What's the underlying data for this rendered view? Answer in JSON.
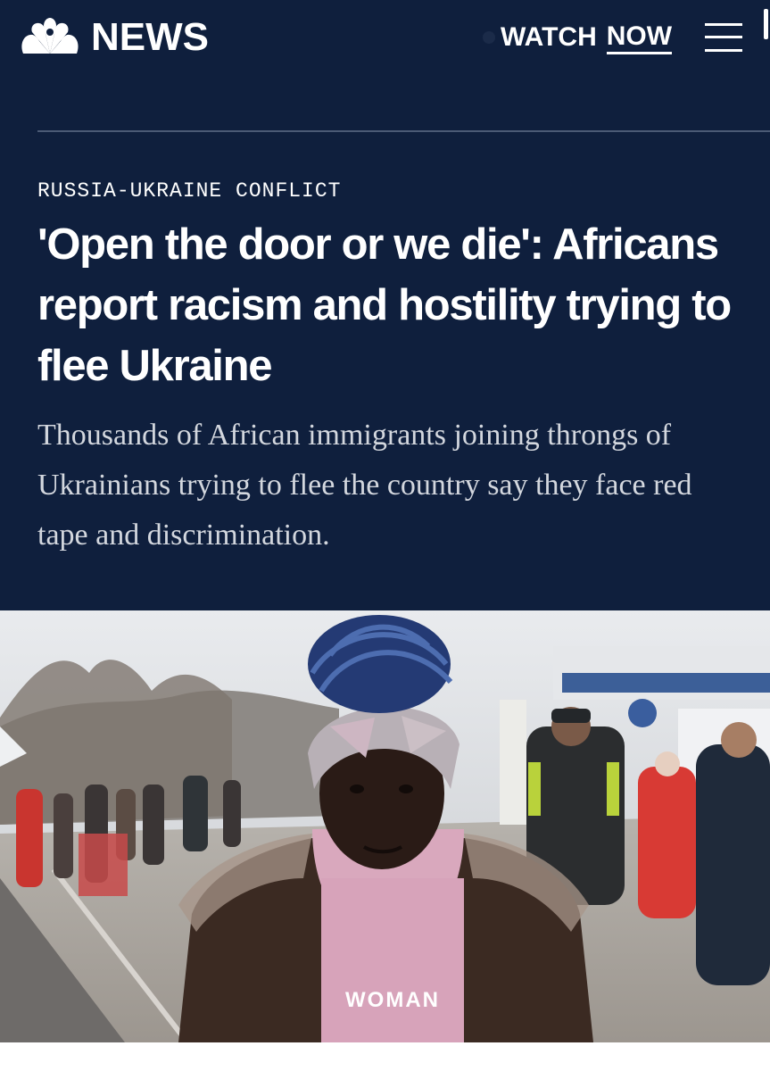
{
  "header": {
    "logo_text": "NEWS",
    "logo_icon": "peacock-icon",
    "watch_label": "WATCH",
    "now_label": "NOW",
    "menu_icon": "hamburger-menu-icon"
  },
  "article": {
    "category": "RUSSIA-UKRAINE CONFLICT",
    "headline": "'Open the door or we die': Africans report racism and hostility trying to flee Ukraine",
    "dek": "Thousands of African immigrants joining throngs of Ukrainians trying to flee the country say they face red tape and discrimination."
  },
  "hero": {
    "hoodie_text": "WOMAN"
  },
  "colors": {
    "header_bg": "#0f1f3d",
    "divider": "#4b5a75",
    "text_primary": "#ffffff",
    "text_dek": "#d3d7de"
  }
}
